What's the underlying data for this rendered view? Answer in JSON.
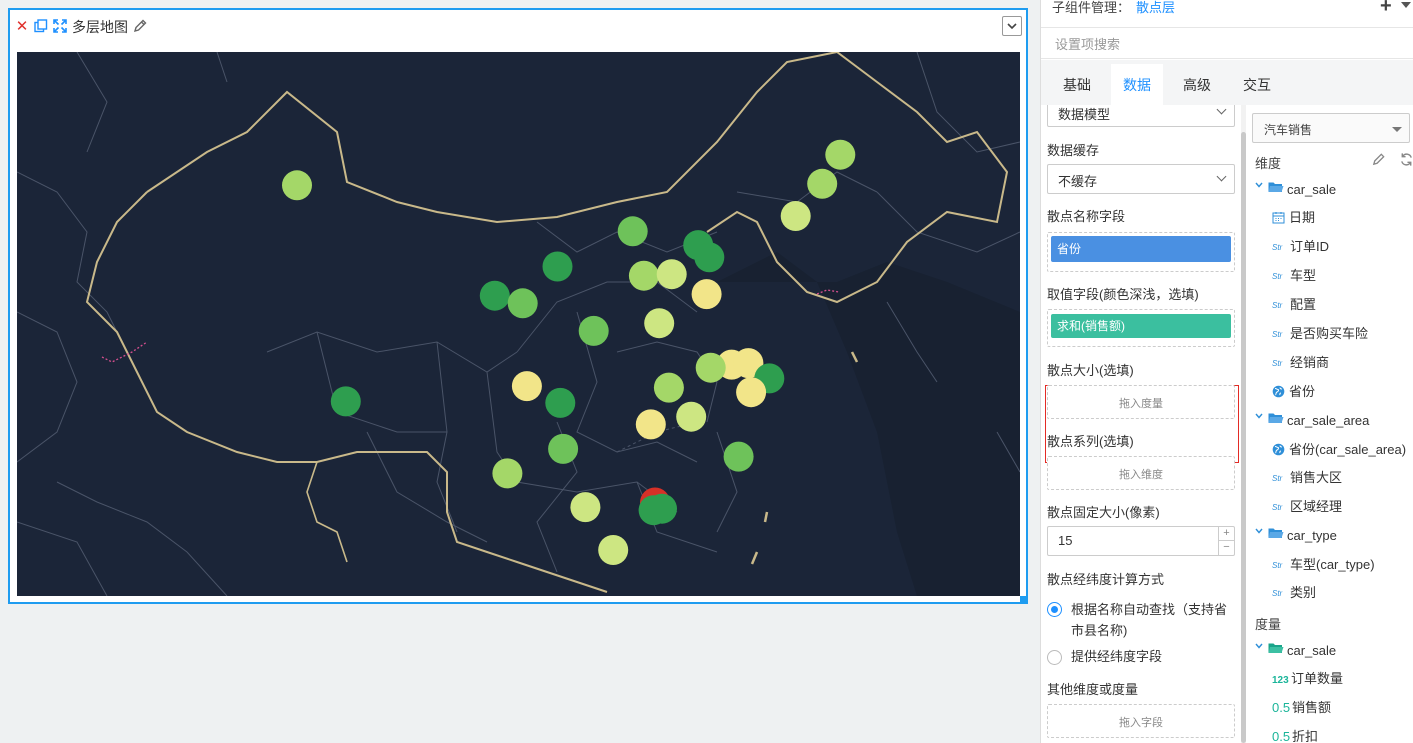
{
  "widget": {
    "title": "多层地图",
    "close_icon": "close-icon",
    "copy_icon": "copy-icon",
    "expand_icon": "expand-icon",
    "edit_icon": "pencil-icon",
    "collapse_icon": "chevron-down-icon"
  },
  "map_points": [
    {
      "lon": 87.6,
      "lat": 43.8,
      "level": 2
    },
    {
      "lon": 126.6,
      "lat": 45.8,
      "level": 2
    },
    {
      "lon": 125.3,
      "lat": 43.9,
      "level": 2
    },
    {
      "lon": 123.4,
      "lat": 41.8,
      "level": 1
    },
    {
      "lon": 111.7,
      "lat": 40.8,
      "level": 3
    },
    {
      "lon": 116.4,
      "lat": 39.9,
      "level": 4
    },
    {
      "lon": 117.2,
      "lat": 39.1,
      "level": 4
    },
    {
      "lon": 106.3,
      "lat": 38.5,
      "level": 4
    },
    {
      "lon": 112.5,
      "lat": 37.9,
      "level": 2
    },
    {
      "lon": 114.5,
      "lat": 38.0,
      "level": 1
    },
    {
      "lon": 117.0,
      "lat": 36.7,
      "level": 0
    },
    {
      "lon": 101.8,
      "lat": 36.6,
      "level": 4
    },
    {
      "lon": 103.8,
      "lat": 36.1,
      "level": 3
    },
    {
      "lon": 113.6,
      "lat": 34.8,
      "level": 1
    },
    {
      "lon": 108.9,
      "lat": 34.3,
      "level": 3
    },
    {
      "lon": 118.8,
      "lat": 32.1,
      "level": 0
    },
    {
      "lon": 120.0,
      "lat": 32.2,
      "level": 0
    },
    {
      "lon": 121.5,
      "lat": 31.2,
      "level": 4
    },
    {
      "lon": 117.3,
      "lat": 31.9,
      "level": 2
    },
    {
      "lon": 114.3,
      "lat": 30.6,
      "level": 2
    },
    {
      "lon": 120.2,
      "lat": 30.3,
      "level": 0
    },
    {
      "lon": 104.1,
      "lat": 30.7,
      "level": 0
    },
    {
      "lon": 106.5,
      "lat": 29.6,
      "level": 4
    },
    {
      "lon": 91.1,
      "lat": 29.7,
      "level": 4
    },
    {
      "lon": 113.0,
      "lat": 28.2,
      "level": 0
    },
    {
      "lon": 115.9,
      "lat": 28.7,
      "level": 1
    },
    {
      "lon": 106.7,
      "lat": 26.6,
      "level": 3
    },
    {
      "lon": 119.3,
      "lat": 26.1,
      "level": 3
    },
    {
      "lon": 102.7,
      "lat": 25.0,
      "level": 2
    },
    {
      "lon": 108.3,
      "lat": 22.8,
      "level": 1
    },
    {
      "lon": 113.3,
      "lat": 23.1,
      "level": 5
    },
    {
      "lon": 113.2,
      "lat": 22.6,
      "level": 4
    },
    {
      "lon": 113.8,
      "lat": 22.7,
      "level": 4
    },
    {
      "lon": 110.3,
      "lat": 20.0,
      "level": 1
    }
  ],
  "map_colors": [
    "#f2e589",
    "#cde682",
    "#a4d768",
    "#6ec25a",
    "#2e9e4f",
    "#d73027"
  ],
  "panel": {
    "sub_manager_label": "子组件管理：",
    "sub_manager_value": "散点层",
    "add_icon": "plus-icon",
    "menu_icon": "caret-down-icon",
    "search_placeholder": "设置项搜索",
    "tabs": [
      "基础",
      "数据",
      "高级",
      "交互"
    ],
    "active_tab": "数据"
  },
  "settings": {
    "data_model_value": "数据模型",
    "cache_label": "数据缓存",
    "cache_value": "不缓存",
    "name_field_label": "散点名称字段",
    "name_field_chip": "省份",
    "value_field_label": "取值字段(颜色深浅，选填)",
    "value_field_chip": "求和(销售额)",
    "size_label": "散点大小(选填)",
    "size_hint": "拖入度量",
    "series_label": "散点系列(选填)",
    "series_hint": "拖入维度",
    "fixed_size_label": "散点固定大小(像素)",
    "fixed_size_value": "15",
    "step_up": "+",
    "step_down": "−",
    "coord_label": "散点经纬度计算方式",
    "coord_option_auto": "根据名称自动查找（支持省市县名称)",
    "coord_option_fields": "提供经纬度字段",
    "other_label": "其他维度或度量",
    "other_hint": "拖入字段",
    "chip_color_name": "#4a90e2",
    "chip_color_value": "#3bbf9f"
  },
  "fields": {
    "dataset": "汽车销售",
    "dim_label": "维度",
    "measure_label": "度量",
    "tool_icons": [
      "pencil-icon",
      "refresh-icon",
      "search-icon"
    ],
    "car_sale": "car_sale",
    "car_sale_items": [
      "日期",
      "订单ID",
      "车型",
      "配置",
      "是否购买车险",
      "经销商",
      "省份"
    ],
    "car_sale_area": "car_sale_area",
    "car_sale_area_items": [
      "省份(car_sale_area)",
      "销售大区",
      "区域经理"
    ],
    "car_type": "car_type",
    "car_type_items": [
      "车型(car_type)",
      "类别"
    ],
    "measure_group": "car_sale",
    "measure_items": [
      "订单数量",
      "销售额",
      "折扣"
    ],
    "type_str": "Str",
    "type_int": "123",
    "type_dec": "0.5"
  }
}
